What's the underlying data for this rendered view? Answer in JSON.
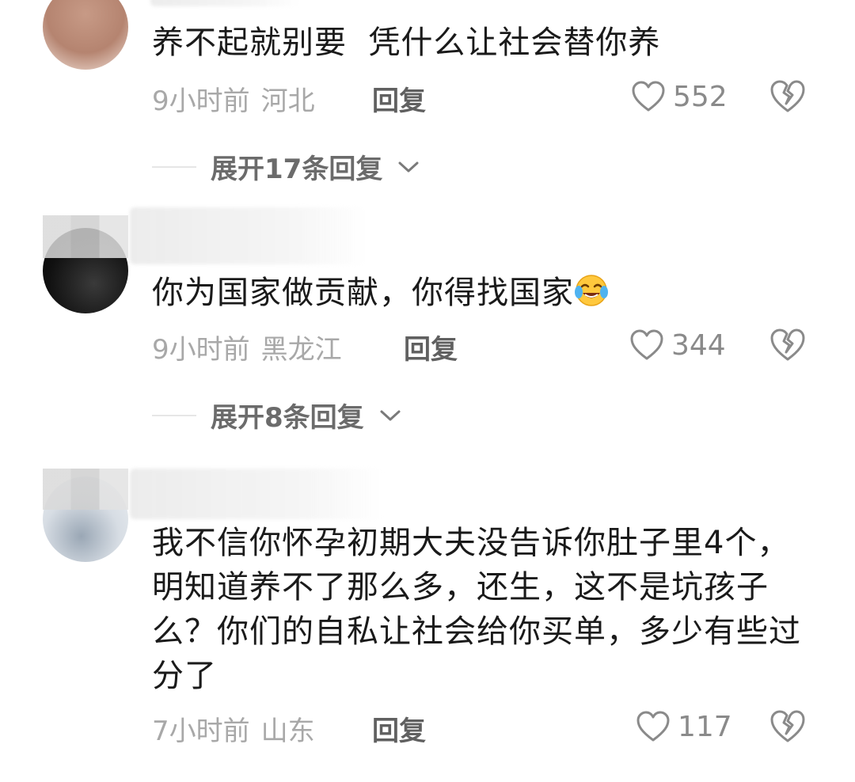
{
  "comments": [
    {
      "name": "",
      "text": "养不起就别要  凭什么让社会替你养",
      "time": "9小时前",
      "location": "河北",
      "reply_label": "回复",
      "likes": "552",
      "expand_label": "展开17条回复"
    },
    {
      "name": "",
      "text": "你为国家做贡献，你得找国家",
      "emoji": "crying-laughing-emoji",
      "time": "9小时前",
      "location": "黑龙江",
      "reply_label": "回复",
      "likes": "344",
      "expand_label": "展开8条回复"
    },
    {
      "name": "",
      "text": "我不信你怀孕初期大夫没告诉你肚子里4个，明知道养不了那么多，还生，这不是坑孩子么？你们的自私让社会给你买单，多少有些过分了",
      "time": "7小时前",
      "location": "山东",
      "reply_label": "回复",
      "likes": "117"
    }
  ],
  "icons": {
    "like": "heart-outline-icon",
    "dislike": "broken-heart-icon",
    "expand": "chevron-down-icon"
  },
  "colors": {
    "text": "#1a1a1a",
    "meta": "#a8a8a8",
    "action": "#606060"
  }
}
